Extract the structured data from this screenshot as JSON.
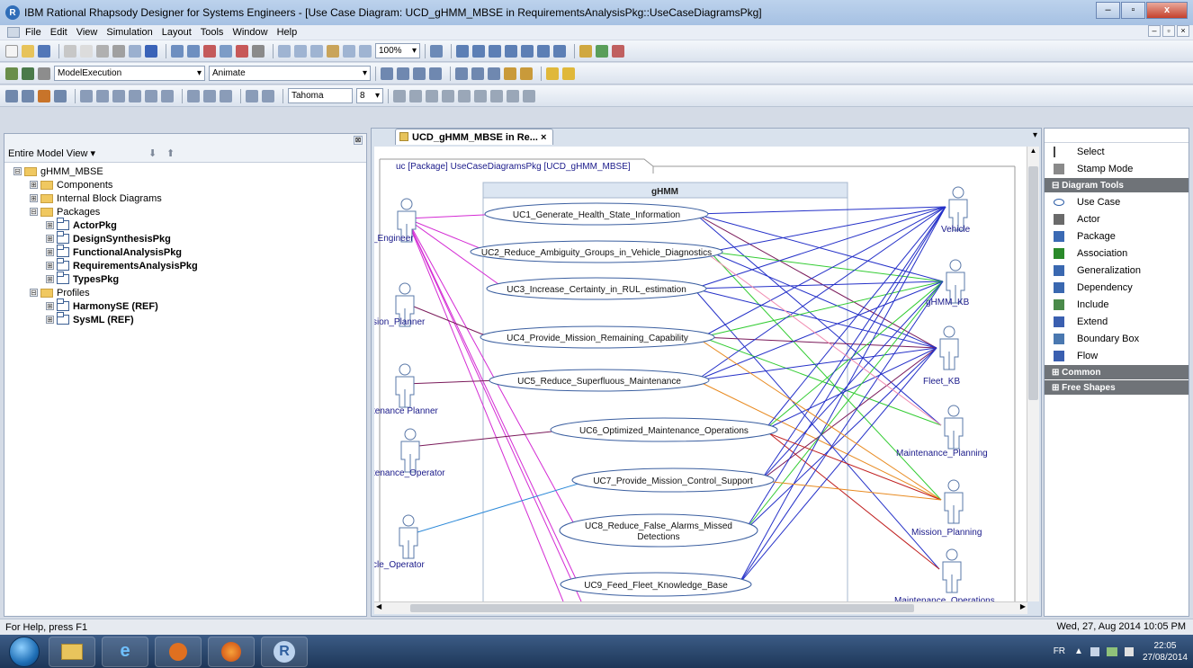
{
  "window": {
    "title": "IBM Rational Rhapsody Designer for Systems Engineers - [Use Case Diagram: UCD_gHMM_MBSE in RequirementsAnalysisPkg::UseCaseDiagramsPkg]",
    "app_icon": "R",
    "controls": {
      "minimize": "–",
      "maximize": "▫",
      "close": "x"
    }
  },
  "menubar": {
    "items": [
      "File",
      "Edit",
      "View",
      "Simulation",
      "Layout",
      "Tools",
      "Window",
      "Help"
    ],
    "mdi_controls": [
      "–",
      "▫",
      "×"
    ]
  },
  "toolbar2": {
    "config_select": "ModelExecution",
    "mode_select": "Animate"
  },
  "toolbar3": {
    "font_select": "Tahoma",
    "size_select": "8"
  },
  "browser": {
    "view_selector": "Entire Model View ▾",
    "tree": [
      {
        "label": "gHMM_MBSE",
        "indent": 0,
        "icon": "folder",
        "exp": "⊟",
        "bold": false
      },
      {
        "label": "Components",
        "indent": 1,
        "icon": "folder",
        "exp": "⊞",
        "bold": false
      },
      {
        "label": "Internal Block Diagrams",
        "indent": 1,
        "icon": "folder",
        "exp": "⊞",
        "bold": false
      },
      {
        "label": "Packages",
        "indent": 1,
        "icon": "folder",
        "exp": "⊟",
        "bold": false
      },
      {
        "label": "ActorPkg",
        "indent": 2,
        "icon": "package",
        "exp": "⊞",
        "bold": true
      },
      {
        "label": "DesignSynthesisPkg",
        "indent": 2,
        "icon": "package",
        "exp": "⊞",
        "bold": true
      },
      {
        "label": "FunctionalAnalysisPkg",
        "indent": 2,
        "icon": "package",
        "exp": "⊞",
        "bold": true
      },
      {
        "label": "RequirementsAnalysisPkg",
        "indent": 2,
        "icon": "package",
        "exp": "⊞",
        "bold": true
      },
      {
        "label": "TypesPkg",
        "indent": 2,
        "icon": "package",
        "exp": "⊞",
        "bold": true
      },
      {
        "label": "Profiles",
        "indent": 1,
        "icon": "folder",
        "exp": "⊟",
        "bold": false
      },
      {
        "label": "HarmonySE (REF)",
        "indent": 2,
        "icon": "package",
        "exp": "⊞",
        "bold": true
      },
      {
        "label": "SysML (REF)",
        "indent": 2,
        "icon": "package",
        "exp": "⊞",
        "bold": true
      }
    ]
  },
  "diagram": {
    "tab_label": "UCD_gHMM_MBSE in Re... ×",
    "frame_label": "uc [Package] UseCaseDiagramsPkg [UCD_gHMM_MBSE]",
    "system_boundary": "gHMM",
    "left_actors": [
      "_Engineer",
      "sion_Planner",
      "tenance Planner",
      "tenance_Operator",
      "cle_Operator"
    ],
    "right_actors": [
      "Vehicle",
      "gHMM_KB",
      "Fleet_KB",
      "Maintenance_Planning",
      "Mission_Planning",
      "Maintenance_Operations"
    ],
    "use_cases": [
      "UC1_Generate_Health_State_Information",
      "UC2_Reduce_Ambiguity_Groups_in_Vehicle_Diagnostics",
      "UC3_Increase_Certainty_in_RUL_estimation",
      "UC4_Provide_Mission_Remaining_Capability",
      "UC5_Reduce_Superfluous_Maintenance",
      "UC6_Optimized_Maintenance_Operations",
      "UC7_Provide_Mission_Control_Support",
      "UC8_Reduce_False_Alarms_Missed",
      "Detections",
      "UC9_Feed_Fleet_Knowledge_Base"
    ]
  },
  "toolbox": {
    "top_items": [
      "Select",
      "Stamp Mode"
    ],
    "section_diagram_tools": "Diagram Tools",
    "diagram_tools": [
      "Use Case",
      "Actor",
      "Package",
      "Association",
      "Generalization",
      "Dependency",
      "Include",
      "Extend",
      "Boundary Box",
      "Flow"
    ],
    "section_common": "Common",
    "section_free_shapes": "Free Shapes"
  },
  "status": {
    "help": "For Help, press F1",
    "datetime": "Wed, 27, Aug 2014  10:05 PM"
  },
  "taskbar": {
    "lang": "FR",
    "time": "22:05",
    "date": "27/08/2014"
  },
  "colors": {
    "magenta": "#d42bd4",
    "purple": "#7a1a5a",
    "blue": "#2430c8",
    "green": "#33cc33",
    "orange": "#e88a20",
    "red": "#c02020",
    "pink": "#f08ab0",
    "ellipse_stroke": "#3b5fa0"
  }
}
